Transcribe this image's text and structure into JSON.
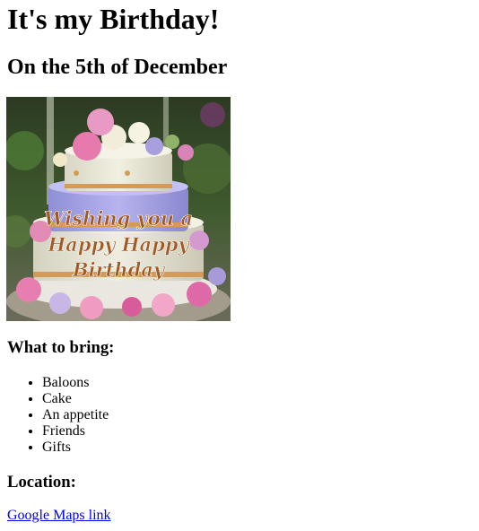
{
  "page": {
    "title": "It's my Birthday!",
    "subtitle": "On the 5th of December",
    "image": {
      "cake_text_lines": [
        "Wishing you a",
        "Happy Happy",
        "Birthday"
      ],
      "icon": "birthday-cake-photo"
    },
    "bring": {
      "heading": "What to bring:",
      "items": [
        "Baloons",
        "Cake",
        "An appetite",
        "Friends",
        "Gifts"
      ]
    },
    "location": {
      "heading": "Location:",
      "link_text": "Google Maps link"
    }
  },
  "colors": {
    "link": "#0000ee",
    "text": "#000000",
    "background": "#ffffff"
  }
}
